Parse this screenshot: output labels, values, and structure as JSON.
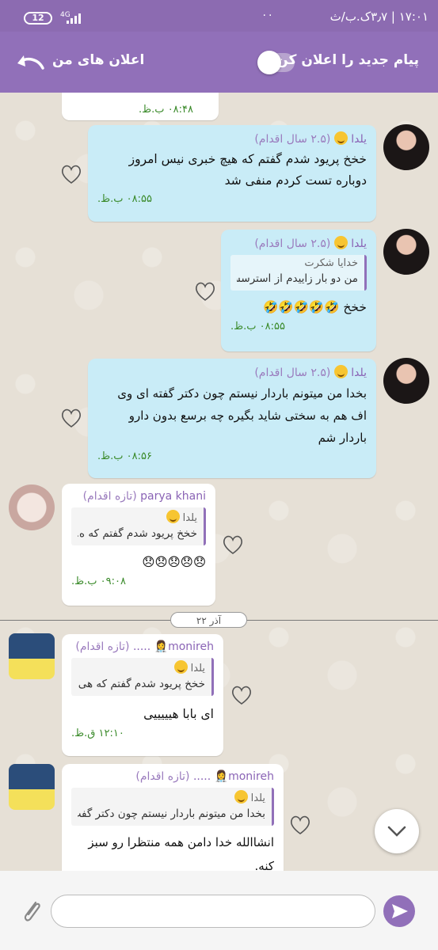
{
  "status_bar": {
    "battery": "12",
    "network": "4G",
    "clock": "۱۷:۰۱ | ۳٫۷ک.ب/ث",
    "icons": "۰۰"
  },
  "header": {
    "title": "اعلان های من",
    "toggle_label": "پیام جدید را اعلان کن",
    "toggle_on": false
  },
  "messages": [
    {
      "time": "۰۸:۴۸ ب.ظ."
    },
    {
      "sender": "یلدا",
      "sender_meta": "(۲.۵ سال اقدام)",
      "text_lines": [
        "خخخ پریود شدم گفتم که هیچ خبری نیس امروز",
        "دوباره تست کردم منفی شد"
      ],
      "time": "۰۸:۵۵ ب.ظ."
    },
    {
      "sender": "یلدا",
      "sender_meta": "(۲.۵ سال اقدام)",
      "quote_name": "خدایا شکرت",
      "quote_text": "من دو بار زاییدم از استرسش",
      "text": "خخخ 🤣🤣🤣🤣🤣",
      "time": "۰۸:۵۵ ب.ظ."
    },
    {
      "sender": "یلدا",
      "sender_meta": "(۲.۵ سال اقدام)",
      "text_lines": [
        "بخدا من میتونم باردار نیستم چون دکتر گفته ای وی",
        "اف هم به سختی شاید بگیره چه برسع بدون دارو",
        "باردار شم"
      ],
      "time": "۰۸:۵۶ ب.ظ."
    },
    {
      "sender": "parya khani",
      "sender_meta": "(تازه اقدام)",
      "quote_name": "یلدا",
      "quote_text": "خخخ پریود شدم گفتم که ه...",
      "text": "😞😞😞😞😞",
      "time": "۰۹:۰۸ ب.ظ."
    },
    {
      "sender": "monireh👩‍⚕️ .....",
      "sender_meta": "(تازه اقدام)",
      "quote_name": "یلدا",
      "quote_text": "خخخ پریود شدم گفتم که هی...",
      "text": "ای بابا هیییییی",
      "time": "۱۲:۱۰ ق.ظ."
    },
    {
      "sender": "monireh👩‍⚕️ .....",
      "sender_meta": "(تازه اقدام)",
      "quote_name": "یلدا",
      "quote_text": "بخدا من میتونم باردار نیستم چون دکتر گفت.",
      "text": "انشاالله خدا دامن همه منتظرا رو سبز کنه."
    }
  ],
  "date_separator": "۲۲ آذر",
  "input": {
    "placeholder": ""
  },
  "colors": {
    "accent": "#9170b9",
    "blue_bubble": "#c9ecf7",
    "time_green": "#3a8a2a"
  }
}
